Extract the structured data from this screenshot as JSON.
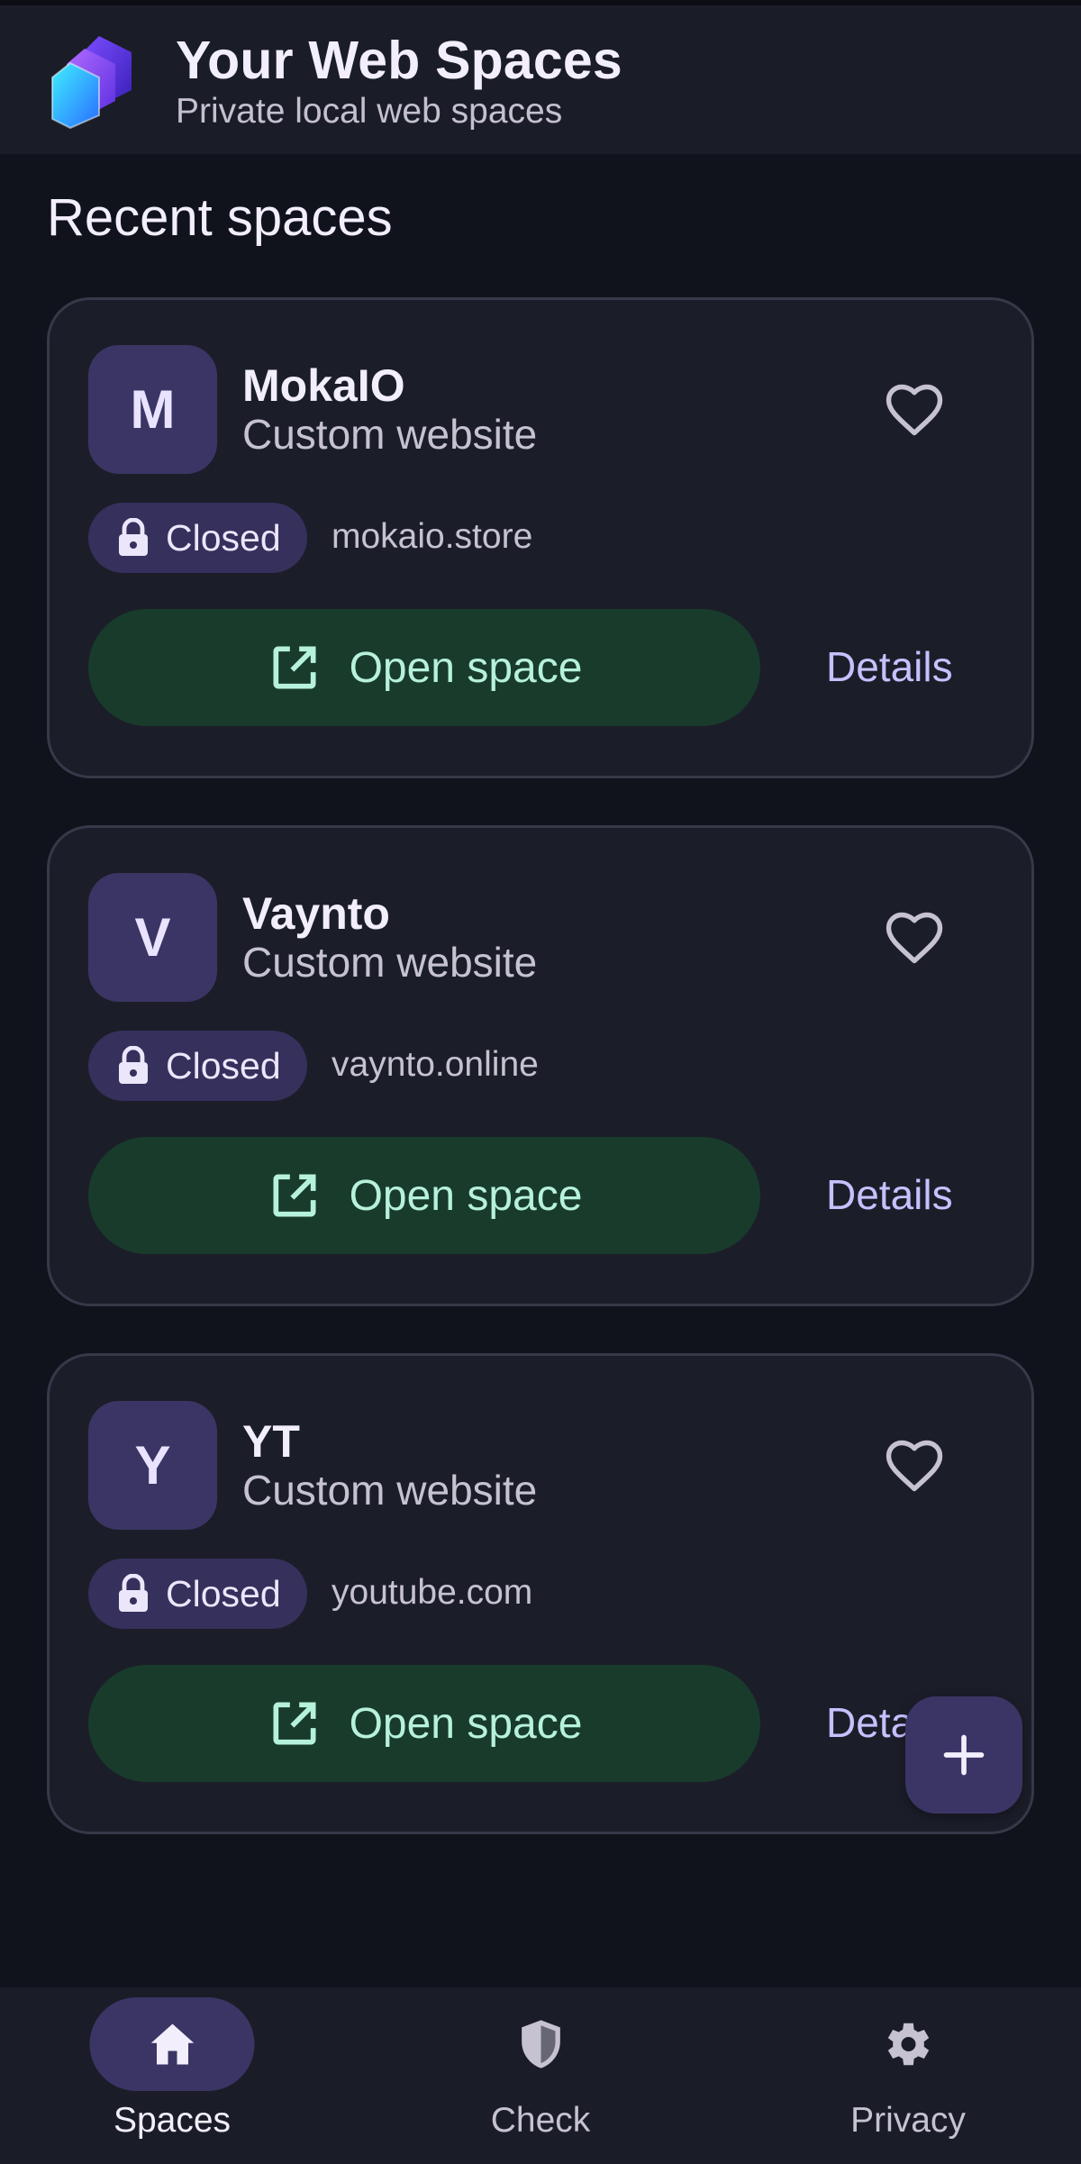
{
  "header": {
    "title": "Your Web Spaces",
    "subtitle": "Private local web spaces",
    "logo_icon": "stacked-cubes-logo"
  },
  "section": {
    "title": "Recent spaces"
  },
  "cards": [
    {
      "initial": "M",
      "name": "MokaIO",
      "type": "Custom website",
      "status": "Closed",
      "domain": "mokaio.store",
      "open_label": "Open space",
      "details_label": "Details",
      "favorite": false
    },
    {
      "initial": "V",
      "name": "Vaynto",
      "type": "Custom website",
      "status": "Closed",
      "domain": "vaynto.online",
      "open_label": "Open space",
      "details_label": "Details",
      "favorite": false
    },
    {
      "initial": "Y",
      "name": "YT",
      "type": "Custom website",
      "status": "Closed",
      "domain": "youtube.com",
      "open_label": "Open space",
      "details_label": "Details",
      "favorite": false
    }
  ],
  "fab": {
    "icon": "plus-icon"
  },
  "nav": {
    "items": [
      {
        "label": "Spaces",
        "icon": "home-icon",
        "active": true
      },
      {
        "label": "Check",
        "icon": "shield-icon",
        "active": false
      },
      {
        "label": "Privacy",
        "icon": "gear-icon",
        "active": false
      }
    ]
  },
  "colors": {
    "background": "#10131b",
    "surface": "#1b1e29",
    "accent": "#3b3566",
    "open_button": "#193b2c",
    "open_text": "#b6f1dc",
    "link": "#c7c0ff"
  }
}
